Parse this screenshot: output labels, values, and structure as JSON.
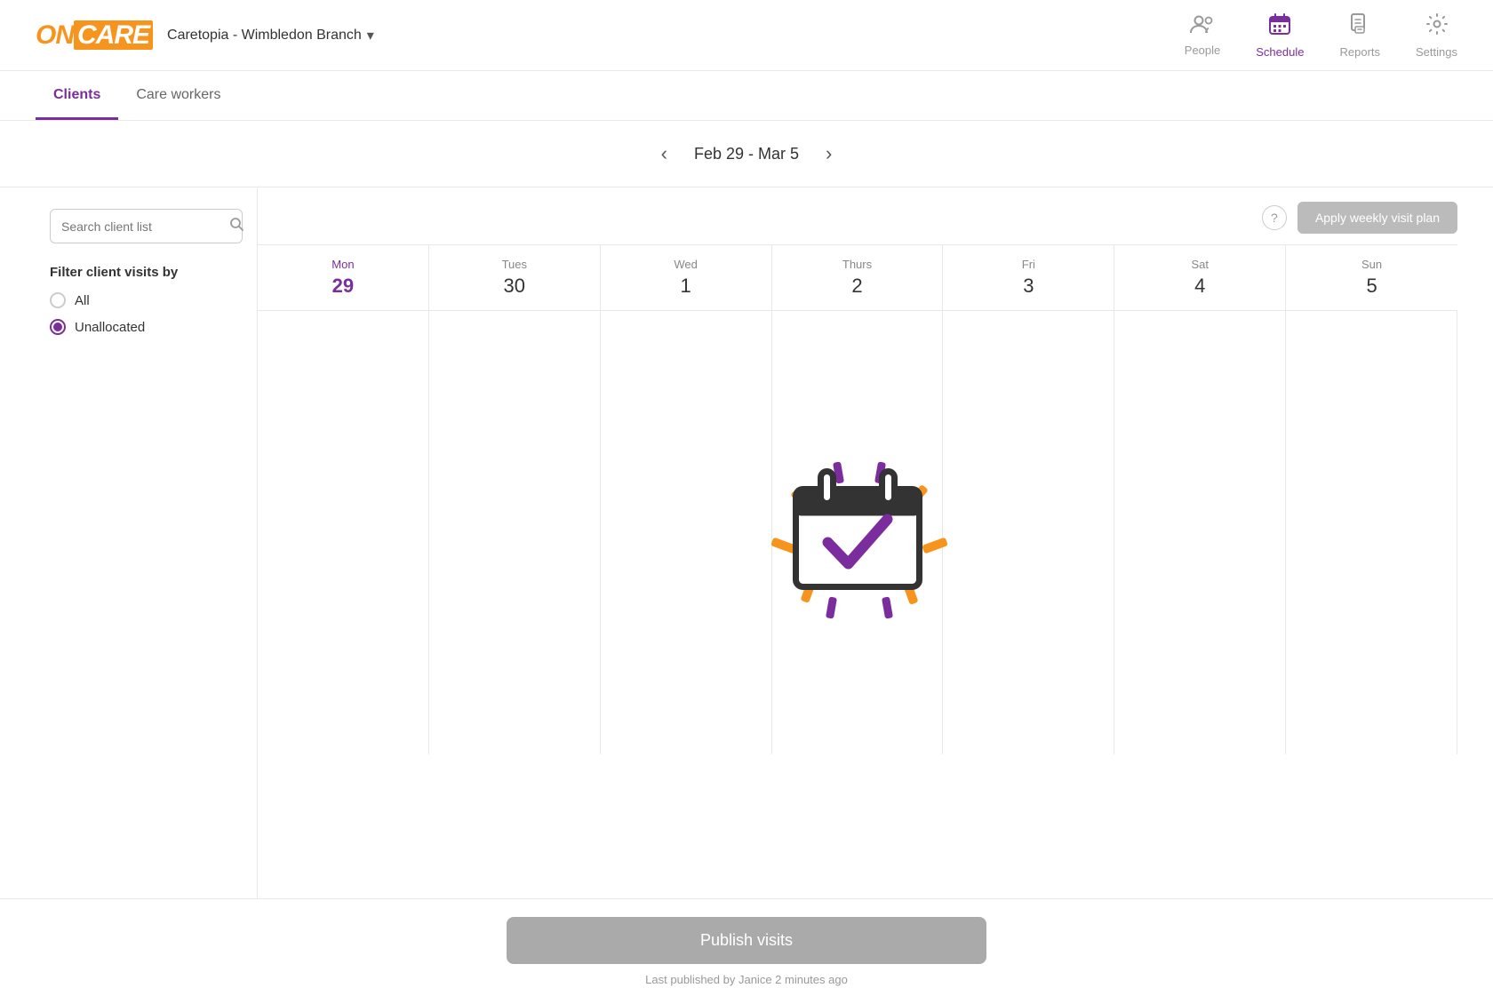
{
  "logo": {
    "text": "ONCARE"
  },
  "branch": {
    "name": "Caretopia - Wimbledon Branch",
    "chevron": "▾"
  },
  "nav": {
    "items": [
      {
        "id": "people",
        "label": "People",
        "icon": "👥",
        "active": false
      },
      {
        "id": "schedule",
        "label": "Schedule",
        "icon": "📅",
        "active": true
      },
      {
        "id": "reports",
        "label": "Reports",
        "icon": "🗂",
        "active": false
      },
      {
        "id": "settings",
        "label": "Settings",
        "icon": "⚙️",
        "active": false
      }
    ]
  },
  "tabs": [
    {
      "id": "clients",
      "label": "Clients",
      "active": true
    },
    {
      "id": "care-workers",
      "label": "Care workers",
      "active": false
    }
  ],
  "date_nav": {
    "prev_label": "‹",
    "next_label": "›",
    "range_label": "Feb 29 - Mar 5"
  },
  "search": {
    "placeholder": "Search client list"
  },
  "filter": {
    "title": "Filter client visits by",
    "options": [
      {
        "id": "all",
        "label": "All",
        "selected": false
      },
      {
        "id": "unallocated",
        "label": "Unallocated",
        "selected": true
      }
    ]
  },
  "calendar": {
    "help_label": "?",
    "apply_btn_label": "Apply weekly visit plan",
    "days": [
      {
        "name": "Mon",
        "num": "29",
        "today": true
      },
      {
        "name": "Tues",
        "num": "30",
        "today": false
      },
      {
        "name": "Wed",
        "num": "1",
        "today": false
      },
      {
        "name": "Thurs",
        "num": "2",
        "today": false
      },
      {
        "name": "Fri",
        "num": "3",
        "today": false
      },
      {
        "name": "Sat",
        "num": "4",
        "today": false
      },
      {
        "name": "Sun",
        "num": "5",
        "today": false
      }
    ]
  },
  "bottom_bar": {
    "publish_label": "Publish visits",
    "last_published": "Last published by Janice 2 minutes ago"
  }
}
